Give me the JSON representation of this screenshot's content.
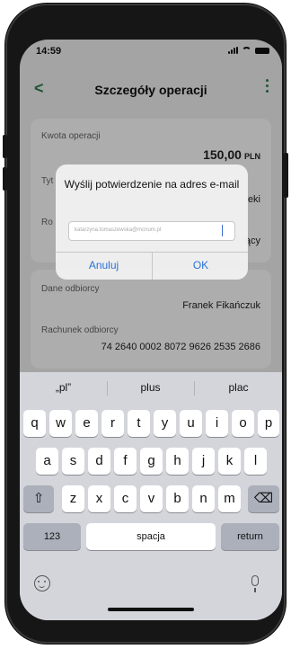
{
  "status_bar": {
    "time": "14:59"
  },
  "nav": {
    "back": "<",
    "title": "Szczegóły operacji"
  },
  "details": {
    "amount_label": "Kwota operacji",
    "amount_value": "150,00",
    "amount_currency": "PLN",
    "title_label_partial": "Tyt",
    "title_value_partial": "eki",
    "recipient_label_partial": "Ro",
    "recipient_value_partial": "ący",
    "recipient_data_label": "Dane odbiorcy",
    "recipient_data_value": "Franek Fikańczuk",
    "account_label": "Rachunek odbiorcy",
    "account_value": "74 2640 0002 8072 9626 2535 2686"
  },
  "dialog": {
    "title": "Wyślij potwierdzenie na adres e-mail",
    "email_value": "katarzyna.tomaszewska@mcnum.pl",
    "cancel_label": "Anuluj",
    "ok_label": "OK"
  },
  "keyboard": {
    "suggestions": [
      "„pl”",
      "plus",
      "plac"
    ],
    "row1": [
      "q",
      "w",
      "e",
      "r",
      "t",
      "y",
      "u",
      "i",
      "o",
      "p"
    ],
    "row2": [
      "a",
      "s",
      "d",
      "f",
      "g",
      "h",
      "j",
      "k",
      "l"
    ],
    "row3": [
      "z",
      "x",
      "c",
      "v",
      "b",
      "n",
      "m"
    ],
    "shift_icon": "⇧",
    "delete_icon": "⌫",
    "numbers_label": "123",
    "space_label": "spacja",
    "return_label": "return"
  },
  "colors": {
    "accent_green": "#2e7d4f",
    "link_blue": "#2a72d8"
  }
}
